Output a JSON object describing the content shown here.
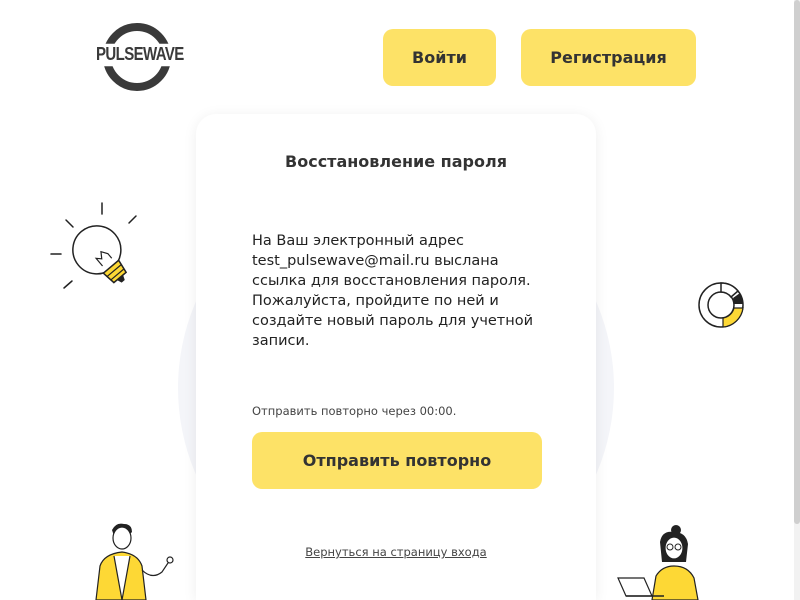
{
  "header": {
    "logo_text": "PULSEWAVE",
    "login_label": "Войти",
    "register_label": "Регистрация"
  },
  "card": {
    "title": "Восстановление пароля",
    "message": "На Ваш электронный адрес test_pulsewave@mail.ru выслана ссылка для восстановления пароля. Пожалуйста, пройдите по ней и создайте новый пароль для учетной записи.",
    "resend_timer": "Отправить повторно через 00:00.",
    "resend_button": "Отправить повторно",
    "back_link": "Вернуться на страницу входа"
  },
  "colors": {
    "accent": "#fde267",
    "text": "#333333",
    "background_circle": "#f4f5f9"
  },
  "icons": [
    "logo-icon",
    "lightbulb-icon",
    "donut-chart-icon",
    "person-illustration-icon",
    "person-laptop-illustration-icon"
  ]
}
